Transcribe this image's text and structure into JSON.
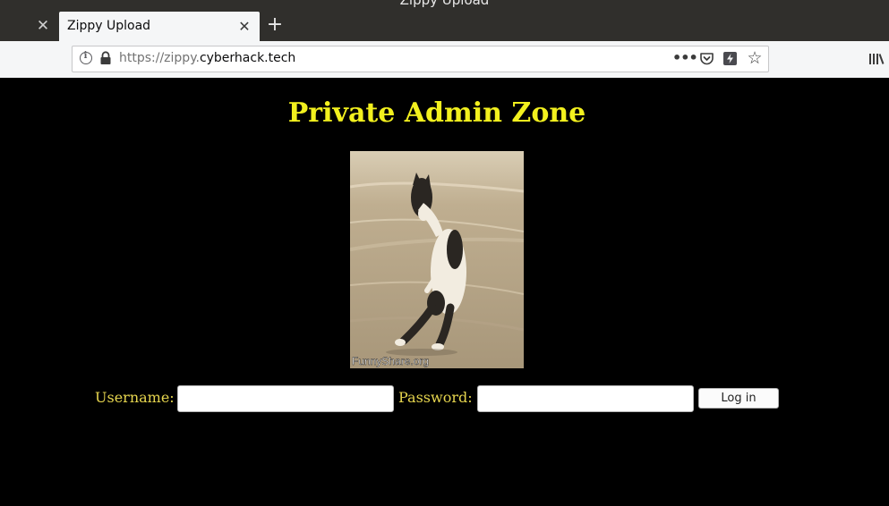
{
  "browser": {
    "window_title": "Zippy Upload",
    "tabs": [
      {
        "label": "Zippy Upload",
        "active": true
      }
    ],
    "url": {
      "scheme_prefix": "https://zippy.",
      "domain": "cyberhack.tech"
    }
  },
  "page": {
    "title": "Private Admin Zone",
    "image": {
      "alt": "cat",
      "watermark": "FunnyShare.org"
    },
    "login": {
      "username_label": "Username:",
      "username_value": "",
      "password_label": "Password:",
      "password_value": "",
      "submit_label": "Log in"
    }
  },
  "colors": {
    "title": "#f2f01e",
    "label": "#e6d54e",
    "page_bg": "#000000",
    "chrome_dark": "#302f2c"
  },
  "icons": {
    "tab_close": "close-icon",
    "new_tab": "plus-icon",
    "site_info": "info-icon",
    "secure": "lock-icon",
    "page_actions": "meatball-menu-icon",
    "pocket": "pocket-icon",
    "reader": "reader-view-icon",
    "bookmark": "star-icon",
    "library": "library-icon"
  }
}
